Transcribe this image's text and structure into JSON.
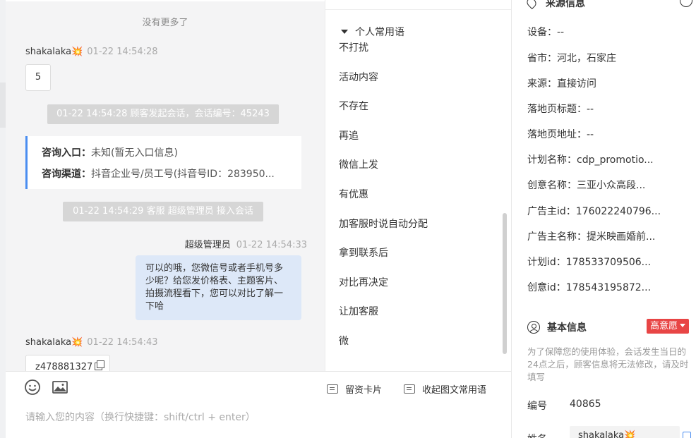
{
  "chat": {
    "no_more": "没有更多了",
    "customer_name": "shakalaka",
    "customer_emoji": "💥",
    "msg1_time": "01-22 14:54:28",
    "msg1_text": "5",
    "sys1": "01-22 14:54:28 顾客发起会话，会话编号：45243",
    "entry_label": "咨询入口：",
    "entry_value": "未知(暂无入口信息)",
    "channel_label": "咨询渠道：",
    "channel_value": "抖音企业号/员工号(抖音号ID：283950...",
    "sys2": "01-22 14:54:29 客服 超级管理员 接入会话",
    "agent_name": "超级管理员",
    "agent_time": "01-22 14:54:33",
    "agent_text": "可以的哦，您微信号或者手机号多少呢？给您发价格表、主题客片、拍摄流程看下，您可以对比了解一下哈",
    "msg2_time": "01-22 14:54:43",
    "msg2_text": "z478881327"
  },
  "input": {
    "card_button": "留资卡片",
    "collapse_button": "收起图文常用语",
    "placeholder": "请输入您的内容（换行快捷键：shift/ctrl + enter）"
  },
  "phrases": {
    "group_title": "个人常用语",
    "items": [
      "不打扰",
      "活动内容",
      "不存在",
      "再追",
      "微信上发",
      "有优惠",
      "加客服时说自动分配",
      "拿到联系后",
      "对比再决定",
      "让加客服",
      "微"
    ]
  },
  "source": {
    "title": "来源信息",
    "device": "设备：--",
    "province": "省市：河北，石家庄",
    "origin": "来源：直接访问",
    "landing_title": "落地页标题：--",
    "landing_url": "落地页地址：--",
    "plan_name": "计划名称：cdp_promotio...",
    "creative_name": "创意名称：三亚小众高段...",
    "advertiser_id": "广告主id：176022240796...",
    "advertiser_name": "广告主名称：提米映画婚前...",
    "plan_id": "计划id：178533709506...",
    "creative_id": "创意id：178543195872..."
  },
  "basic": {
    "title": "基本信息",
    "badge": "高意愿",
    "note": "为了保障您的使用体验，会话发生当日的24点之后，顾客信息将无法修改，请及时填写",
    "number_label": "编号",
    "number_value": "40865",
    "name_label": "姓名",
    "name_value": "shakalaka💥"
  }
}
